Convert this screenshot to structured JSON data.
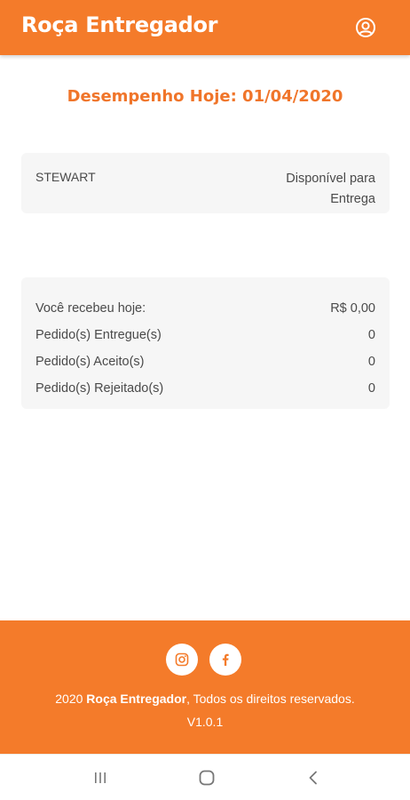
{
  "app_bar": {
    "title": "Roça Entregador",
    "account_icon": "user-circle-icon",
    "background": "#f47b2a"
  },
  "heading": {
    "title": "Desempenho Hoje: 01/04/2020",
    "color": "#f0752a"
  },
  "status_card": {
    "driver_name": "STEWART",
    "status": "Disponível para Entrega"
  },
  "stats": [
    {
      "label": "Você recebeu hoje:",
      "value": "R$ 0,00"
    },
    {
      "label": "Pedido(s) Entregue(s)",
      "value": "0"
    },
    {
      "label": "Pedido(s) Aceito(s)",
      "value": "0"
    },
    {
      "label": "Pedido(s) Rejeitado(s)",
      "value": "0"
    }
  ],
  "footer": {
    "year": "2020",
    "brand": "Roça Entregador",
    "rights": ", Todos os direitos reservados.",
    "version": "V1.0.1",
    "social": [
      {
        "icon": "instagram-icon"
      },
      {
        "icon": "facebook-icon"
      }
    ]
  },
  "system_nav": {
    "buttons": [
      "recent-apps-icon",
      "home-icon",
      "back-icon"
    ]
  }
}
